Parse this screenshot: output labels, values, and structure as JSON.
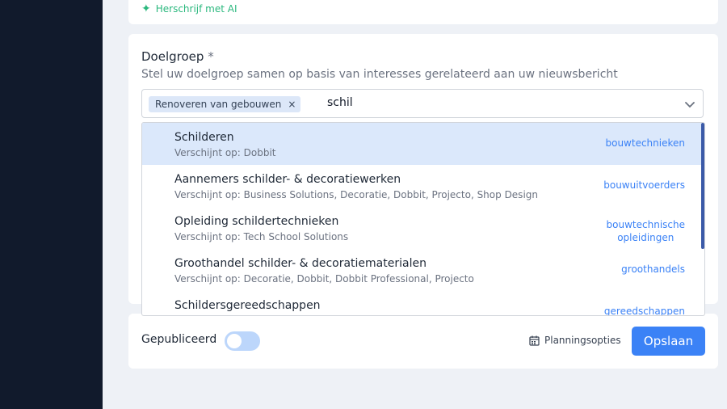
{
  "ai_rewrite": {
    "label": "Herschrijf met AI",
    "icon": "sparkle-icon"
  },
  "audience": {
    "label": "Doelgroep",
    "required_marker": "*",
    "help": "Stel uw doelgroep samen op basis van interesses gerelateerd aan uw nieuwsbericht",
    "chip": "Renoveren van gebouwen",
    "chip_remove": "×",
    "search_value": "schil"
  },
  "options": [
    {
      "title": "Schilderen",
      "sub": "Verschijnt op: Dobbit",
      "category": "bouwtechnieken"
    },
    {
      "title": "Aannemers schilder- & decoratiewerken",
      "sub": "Verschijnt op: Business Solutions, Decoratie, Dobbit, Projecto, Shop Design",
      "category": "bouwuitvoerders"
    },
    {
      "title": "Opleiding schildertechnieken",
      "sub": "Verschijnt op: Tech School Solutions",
      "category": "bouwtechnische opleidingen",
      "category_line1": "bouwtechnische",
      "category_line2": "opleidingen"
    },
    {
      "title": "Groothandel schilder- & decoratiematerialen",
      "sub": "Verschijnt op: Decoratie, Dobbit, Dobbit Professional, Projecto",
      "category": "groothandels"
    },
    {
      "title": "Schildersgereedschappen",
      "sub": "",
      "category": "gereedschappen"
    }
  ],
  "footer": {
    "published_label": "Gepubliceerd",
    "published": false,
    "planning_label": "Planningsopties",
    "save_label": "Opslaan"
  },
  "colors": {
    "accent": "#3b82f6",
    "sidebar": "#111a2c",
    "ai": "#2bb87e"
  }
}
